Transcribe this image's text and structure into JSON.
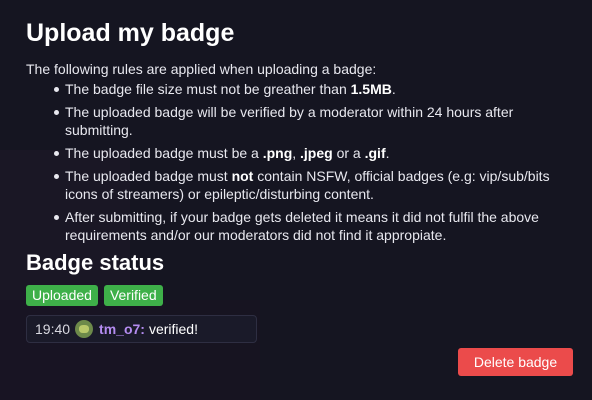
{
  "title": "Upload my badge",
  "intro": "The following rules are applied when uploading a badge:",
  "rules": [
    {
      "pre": "The badge file size must not be greather than ",
      "b1": "1.5MB",
      "mid1": ".",
      "b2": "",
      "mid2": "",
      "b3": "",
      "mid3": "",
      "b4": "",
      "post": ""
    },
    {
      "pre": "The uploaded badge will be verified by a moderator within 24 hours after submitting.",
      "b1": "",
      "mid1": "",
      "b2": "",
      "mid2": "",
      "b3": "",
      "mid3": "",
      "b4": "",
      "post": ""
    },
    {
      "pre": "The uploaded badge must be a ",
      "b1": ".png",
      "mid1": ", ",
      "b2": ".jpeg",
      "mid2": " or a ",
      "b3": ".gif",
      "mid3": ".",
      "b4": "",
      "post": ""
    },
    {
      "pre": "The uploaded badge must ",
      "b1": "not",
      "mid1": " contain NSFW, official badges (e.g: vip/sub/bits icons of streamers) or epileptic/disturbing content.",
      "b2": "",
      "mid2": "",
      "b3": "",
      "mid3": "",
      "b4": "",
      "post": ""
    },
    {
      "pre": "After submitting, if your badge gets deleted it means it did not fulfil the above requirements and/or our moderators did not find it appropiate.",
      "b1": "",
      "mid1": "",
      "b2": "",
      "mid2": "",
      "b3": "",
      "mid3": "",
      "b4": "",
      "post": ""
    }
  ],
  "status": {
    "title": "Badge status",
    "badges": [
      "Uploaded",
      "Verified"
    ],
    "badge_color": "#3eb049"
  },
  "chat": {
    "time": "19:40",
    "emote_icon": "frog-emote-icon",
    "username": "tm_o7:",
    "message": "verified!"
  },
  "delete_button": "Delete badge",
  "colors": {
    "background": "#151521",
    "danger": "#eb4b4b",
    "username": "#b48cf0"
  }
}
